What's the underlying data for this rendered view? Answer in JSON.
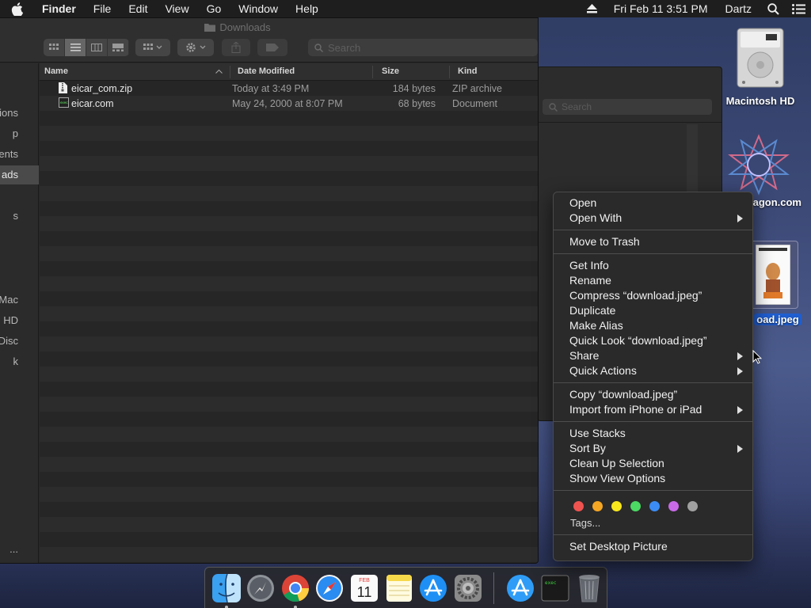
{
  "menubar": {
    "apple_icon": "apple-icon",
    "items": [
      "Finder",
      "File",
      "Edit",
      "View",
      "Go",
      "Window",
      "Help"
    ],
    "datetime": "Fri Feb 11  3:51 PM",
    "user": "Dartz"
  },
  "finder": {
    "title": "Downloads",
    "search_placeholder": "Search",
    "columns": {
      "name": "Name",
      "date": "Date Modified",
      "size": "Size",
      "kind": "Kind"
    },
    "files": [
      {
        "name": "eicar_com.zip",
        "date": "Today at 3:49 PM",
        "size": "184 bytes",
        "kind": "ZIP archive"
      },
      {
        "name": "eicar.com",
        "date": "May 24, 2000 at 8:07 PM",
        "size": "68 bytes",
        "kind": "Document"
      }
    ],
    "sidebar": [
      "tions",
      "p",
      "ents",
      "ads",
      "s",
      "iMac",
      "sh HD",
      " Disc",
      "k",
      "..."
    ]
  },
  "bg_window": {
    "search_placeholder": "Search"
  },
  "desktop": {
    "icons": [
      {
        "label": "Macintosh HD"
      },
      {
        "label": "agon.com"
      },
      {
        "label": "oad.jpeg"
      }
    ]
  },
  "context_menu": {
    "groups": [
      [
        {
          "label": "Open"
        },
        {
          "label": "Open With",
          "submenu": true
        }
      ],
      [
        {
          "label": "Move to Trash"
        }
      ],
      [
        {
          "label": "Get Info"
        },
        {
          "label": "Rename"
        },
        {
          "label": "Compress “download.jpeg”"
        },
        {
          "label": "Duplicate"
        },
        {
          "label": "Make Alias"
        },
        {
          "label": "Quick Look “download.jpeg”"
        },
        {
          "label": "Share",
          "submenu": true
        },
        {
          "label": "Quick Actions",
          "submenu": true
        }
      ],
      [
        {
          "label": "Copy “download.jpeg”"
        },
        {
          "label": "Import from iPhone or iPad",
          "submenu": true
        }
      ],
      [
        {
          "label": "Use Stacks"
        },
        {
          "label": "Sort By",
          "submenu": true
        },
        {
          "label": "Clean Up Selection"
        },
        {
          "label": "Show View Options"
        }
      ]
    ],
    "tag_colors": [
      "#ef5350",
      "#f5a623",
      "#f8e71c",
      "#4cd964",
      "#3b8df5",
      "#c86ae8",
      "#a0a0a0"
    ],
    "tags_label": "Tags...",
    "last_item": "Set Desktop Picture"
  },
  "dock": {
    "apps": [
      "finder-icon",
      "launchpad-icon",
      "chrome-icon",
      "safari-icon",
      "calendar-icon",
      "notes-icon",
      "app-store-icon",
      "system-preferences-icon"
    ],
    "calendar": {
      "month": "FEB",
      "day": "11"
    },
    "others": [
      "app-store-folder-icon",
      "terminal-exec-icon",
      "trash-icon"
    ],
    "exec_label": "exec"
  }
}
